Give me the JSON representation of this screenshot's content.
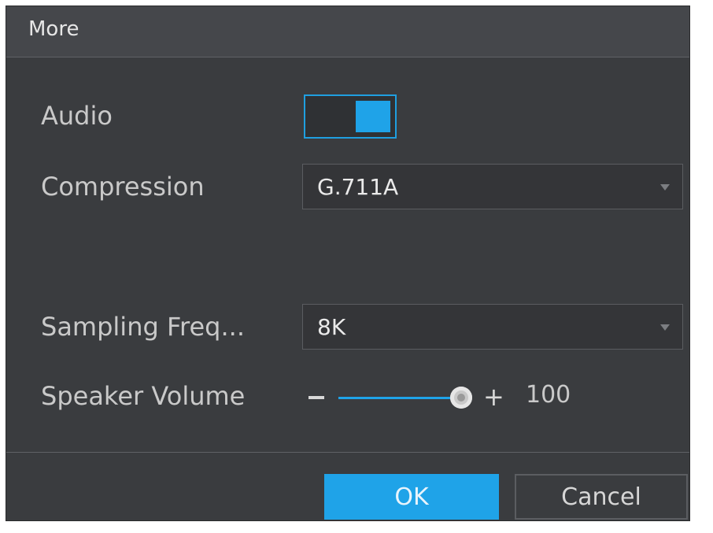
{
  "dialog": {
    "title": "More"
  },
  "audio": {
    "label": "Audio",
    "enabled": true
  },
  "compression": {
    "label": "Compression",
    "value": "G.711A"
  },
  "sampling": {
    "label": "Sampling Freq...",
    "value": "8K"
  },
  "volume": {
    "label": "Speaker Volume",
    "value": "100",
    "level_percent": 100
  },
  "buttons": {
    "ok": "OK",
    "cancel": "Cancel"
  },
  "colors": {
    "accent": "#1fa3e8",
    "dialog_bg": "#3a3c3f",
    "titlebar_bg": "#45474b"
  }
}
